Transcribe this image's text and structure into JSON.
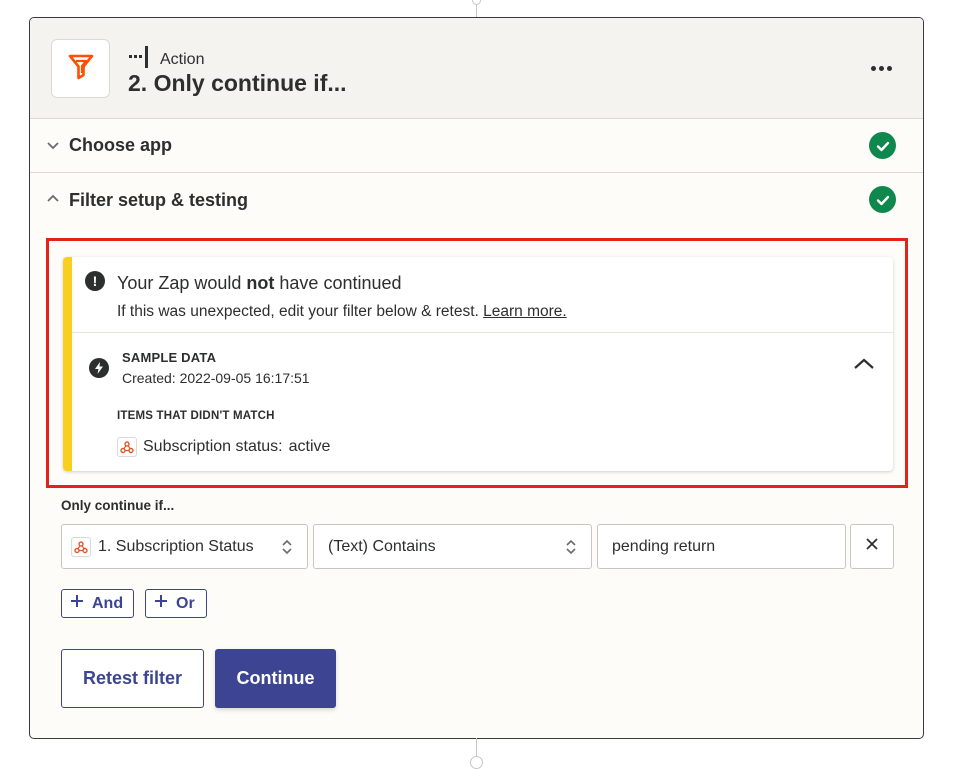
{
  "step": {
    "type_label": "Action",
    "title": "2. Only continue if...",
    "app_icon": "filter-icon",
    "more_icon": "more-horizontal-icon"
  },
  "sections": [
    {
      "label": "Choose app",
      "state": "collapsed",
      "complete": true
    },
    {
      "label": "Filter setup & testing",
      "state": "expanded",
      "complete": true
    }
  ],
  "alert": {
    "title_prefix": "Your Zap would ",
    "title_bold": "not",
    "title_suffix": " have continued",
    "subtitle": "If this was unexpected, edit your filter below & retest.",
    "link": "Learn more.",
    "sample_title": "SAMPLE DATA",
    "sample_created": "Created: 2022-09-05 16:17:51",
    "nomatch_title": "ITEMS THAT DIDN'T MATCH",
    "nomatch_item_label": "Subscription status:",
    "nomatch_item_value": "active"
  },
  "filter": {
    "heading": "Only continue if...",
    "field": "1. Subscription Status",
    "condition": "(Text) Contains",
    "value": "pending return",
    "and_label": "And",
    "or_label": "Or"
  },
  "actions": {
    "retest_label": "Retest filter",
    "continue_label": "Continue"
  },
  "colors": {
    "accent": "#3d4592",
    "success": "#0f884e",
    "warning": "#f8ce1f",
    "highlight": "#e2231a",
    "filter_orange": "#ff4f00"
  }
}
